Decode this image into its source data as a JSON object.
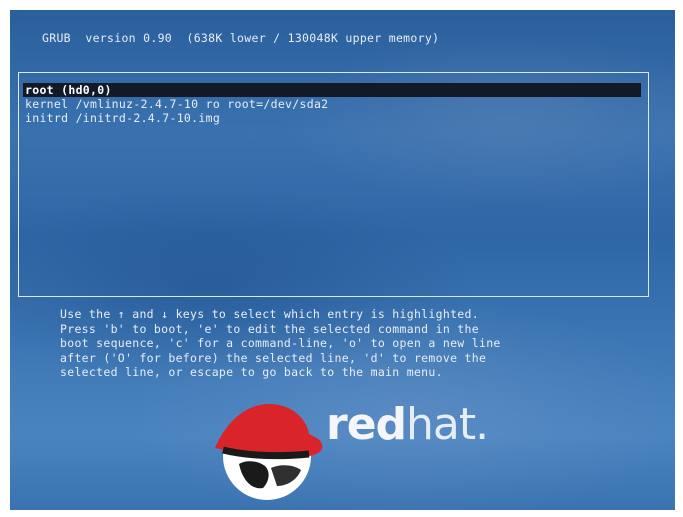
{
  "header": {
    "text": "GRUB  version 0.90  (638K lower / 130048K upper memory)"
  },
  "menu": {
    "entries": [
      {
        "text": "root (hd0,0)",
        "selected": true
      },
      {
        "text": "kernel /vmlinuz-2.4.7-10 ro root=/dev/sda2",
        "selected": false
      },
      {
        "text": "initrd /initrd-2.4.7-10.img",
        "selected": false
      }
    ]
  },
  "help": {
    "lines": [
      "Use the ↑ and ↓ keys to select which entry is highlighted.",
      "Press 'b' to boot, 'e' to edit the selected command in the",
      "boot sequence, 'c' for a command-line, 'o' to open a new line",
      "after ('O' for before) the selected line, 'd' to remove the",
      "selected line, or escape to go back to the main menu."
    ]
  },
  "logo": {
    "word_bold": "red",
    "word_thin": "hat.",
    "hat_color": "#d9252a",
    "face_color": "#ffffff"
  },
  "colors": {
    "background": "#3268a8",
    "text": "#e8eef6",
    "selection_bg": "#121a28"
  }
}
